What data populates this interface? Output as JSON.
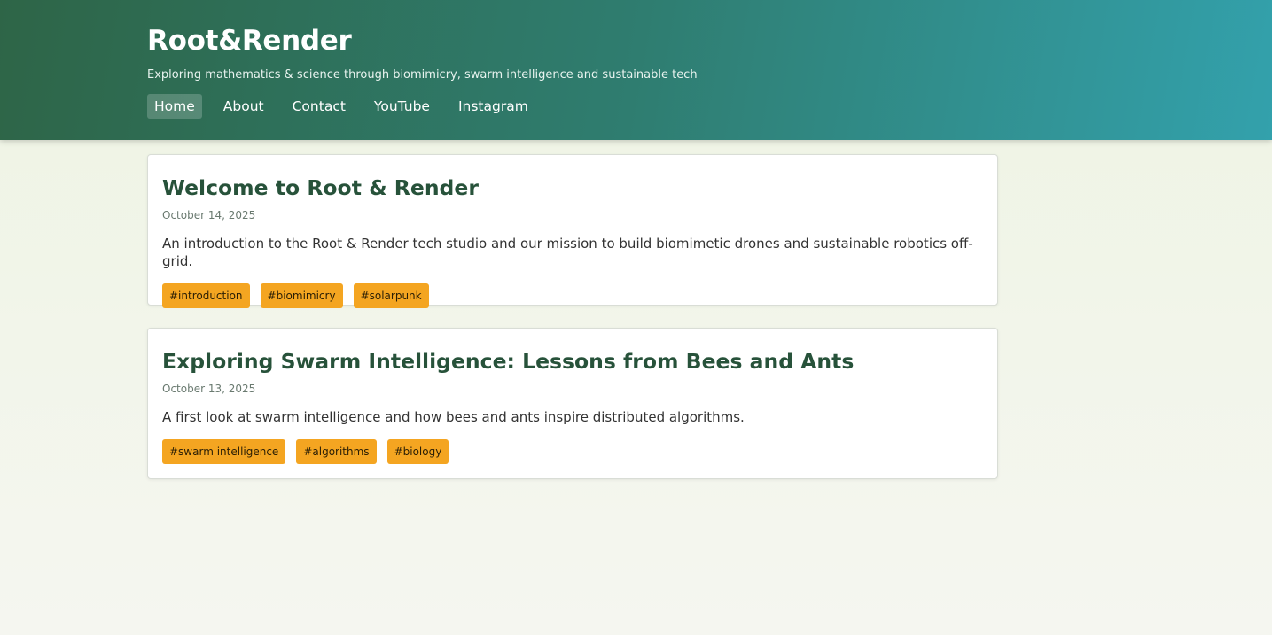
{
  "header": {
    "title": "Root&Render",
    "tagline": "Exploring mathematics & science through biomimicry, swarm intelligence and sustainable tech",
    "nav": [
      {
        "label": "Home",
        "active": true
      },
      {
        "label": "About"
      },
      {
        "label": "Contact"
      },
      {
        "label": "YouTube"
      },
      {
        "label": "Instagram"
      }
    ]
  },
  "posts": [
    {
      "title": "Welcome to Root & Render",
      "date": "October 14, 2025",
      "excerpt": "An introduction to the Root & Render tech studio and our mission to build biomimetic drones and sustainable robotics off-grid.",
      "tags": [
        "#introduction",
        "#biomimicry",
        "#solarpunk"
      ]
    },
    {
      "title": "Exploring Swarm Intelligence: Lessons from Bees and Ants",
      "date": "October 13, 2025",
      "excerpt": "A first look at swarm intelligence and how bees and ants inspire distributed algorithms.",
      "tags": [
        "#swarm intelligence",
        "#algorithms",
        "#biology"
      ]
    }
  ],
  "colors": {
    "header_gradient_start": "#2e6547",
    "header_gradient_end": "#33a1ac",
    "title_green": "#27523a",
    "tag_orange": "#f4a521"
  }
}
